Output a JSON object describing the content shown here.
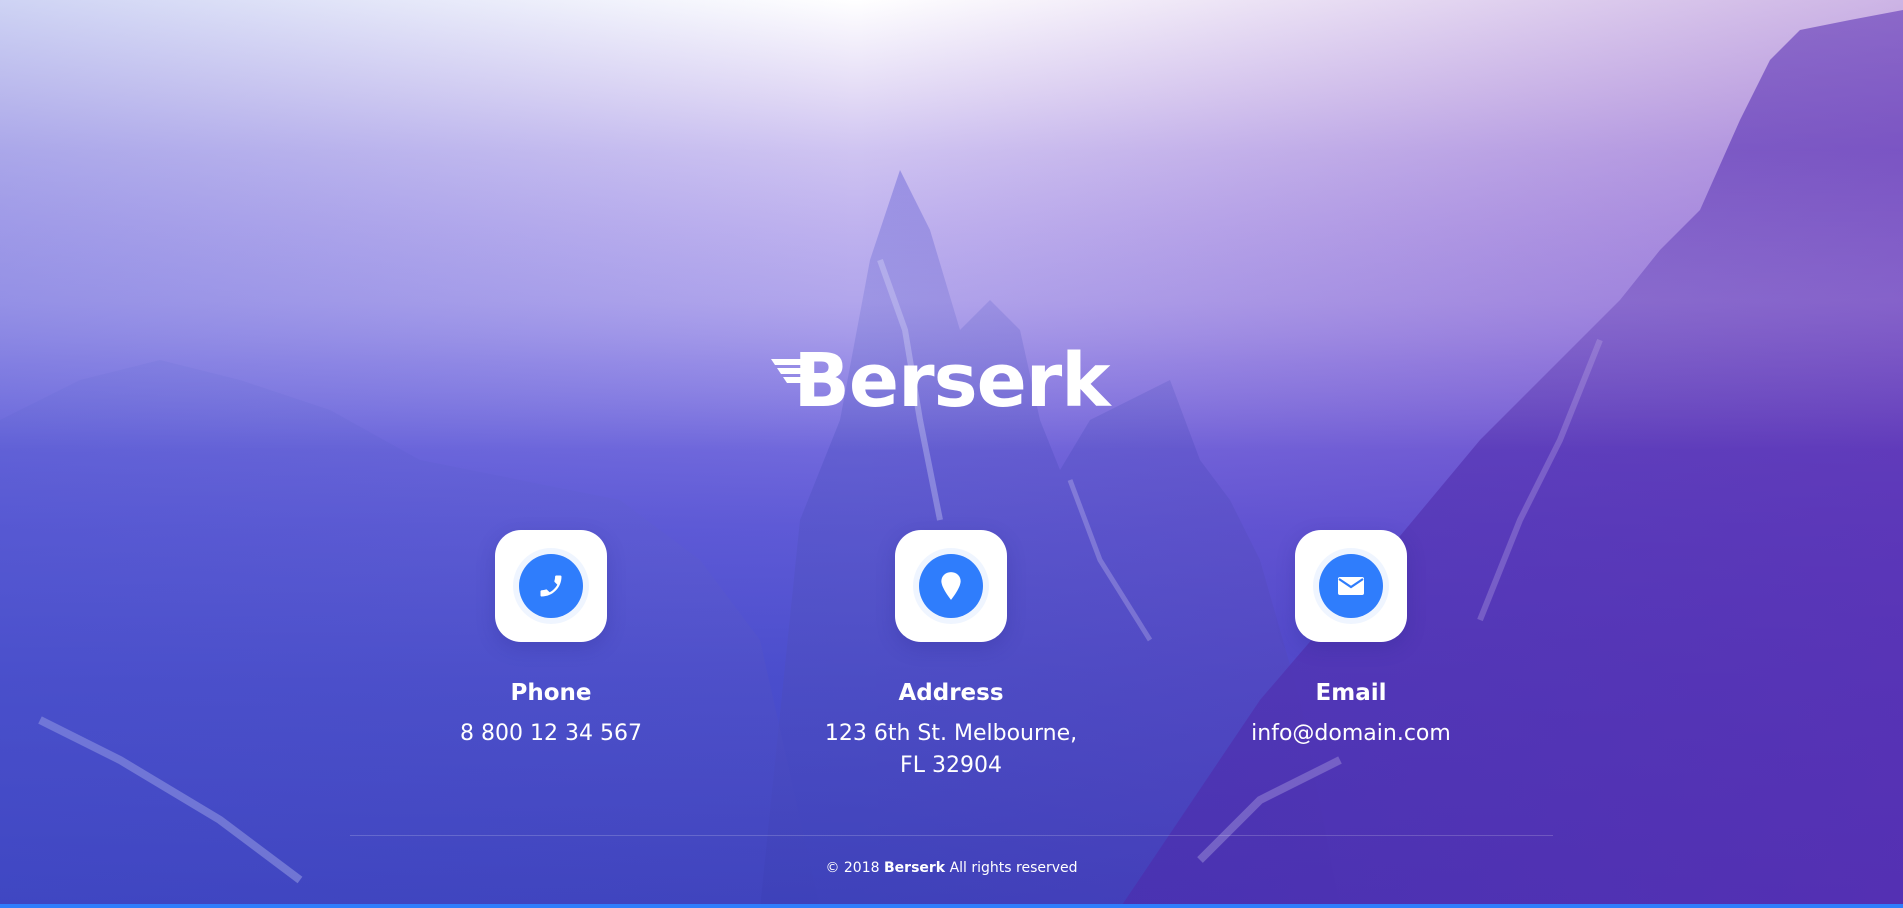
{
  "brand": {
    "name": "Berserk",
    "accent_color": "#2f7dfc"
  },
  "contacts": [
    {
      "icon": "phone-icon",
      "title": "Phone",
      "value": "8 800 12 34 567"
    },
    {
      "icon": "map-pin-icon",
      "title": "Address",
      "value_line1": "123 6th St. Melbourne,",
      "value_line2": "FL 32904"
    },
    {
      "icon": "envelope-icon",
      "title": "Email",
      "value": "info@domain.com"
    }
  ],
  "footer": {
    "copyright_prefix": "© 2018",
    "copyright_brand": "Berserk",
    "copyright_suffix": "All rights reserved"
  }
}
